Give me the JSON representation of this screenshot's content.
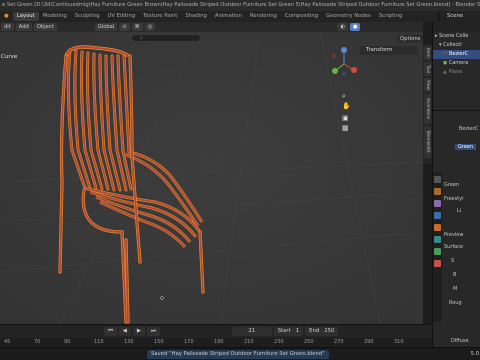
{
  "titlebar": {
    "text": "e Set Green [D:\\3d\\Continuedmig\\Hay Furniture Green Brown\\Hay Palissade Striped Outdoor Furniture Set Green 5\\Hay Palissade Striped Outdoor Furniture Set Green.blend] - Blender 5.0.1"
  },
  "workspace_tabs": [
    "Layout",
    "Modeling",
    "Sculpting",
    "UV Editing",
    "Texture Paint",
    "Shading",
    "Animation",
    "Rendering",
    "Compositing",
    "Geometry Nodes",
    "Scripting"
  ],
  "active_tab": "Layout",
  "scene_label": "Scene",
  "header": {
    "mode": "",
    "menus": [
      "dit",
      "Add",
      "Object"
    ],
    "transform_orient": "Global",
    "options": "Options"
  },
  "viewport": {
    "label": "Curve",
    "transform_panel": "Transform"
  },
  "side_tabs": [
    "Item",
    "Tool",
    "View",
    "Animation",
    "BlenderKit"
  ],
  "outliner": {
    "rows": [
      "Scene Colle",
      "Collecti",
      "BezierC",
      "Camera",
      "Plane"
    ]
  },
  "properties": {
    "object_name": "BezierC",
    "material": "Green",
    "sections": [
      "Green",
      "Freestyl",
      "Li",
      "Preview",
      "Surface",
      "S",
      "B",
      "M",
      "Roug",
      "Diffuse"
    ]
  },
  "timeline": {
    "current_frame": "21",
    "start_label": "Start",
    "start_value": "1",
    "end_label": "End",
    "end_value": "250"
  },
  "frame_numbers": [
    "45",
    "70",
    "90",
    "110",
    "130",
    "150",
    "170",
    "190",
    "210",
    "230",
    "250",
    "270",
    "290",
    "310"
  ],
  "status": {
    "message": "Saved \"Hay Palissade Striped Outdoor Furniture Set Green.blend\"",
    "version": "5.0"
  },
  "colors": {
    "selection_outline": "#e8892e",
    "chair": "#b04a36",
    "viewport_bg": "#393939",
    "accent": "#5680c2"
  }
}
